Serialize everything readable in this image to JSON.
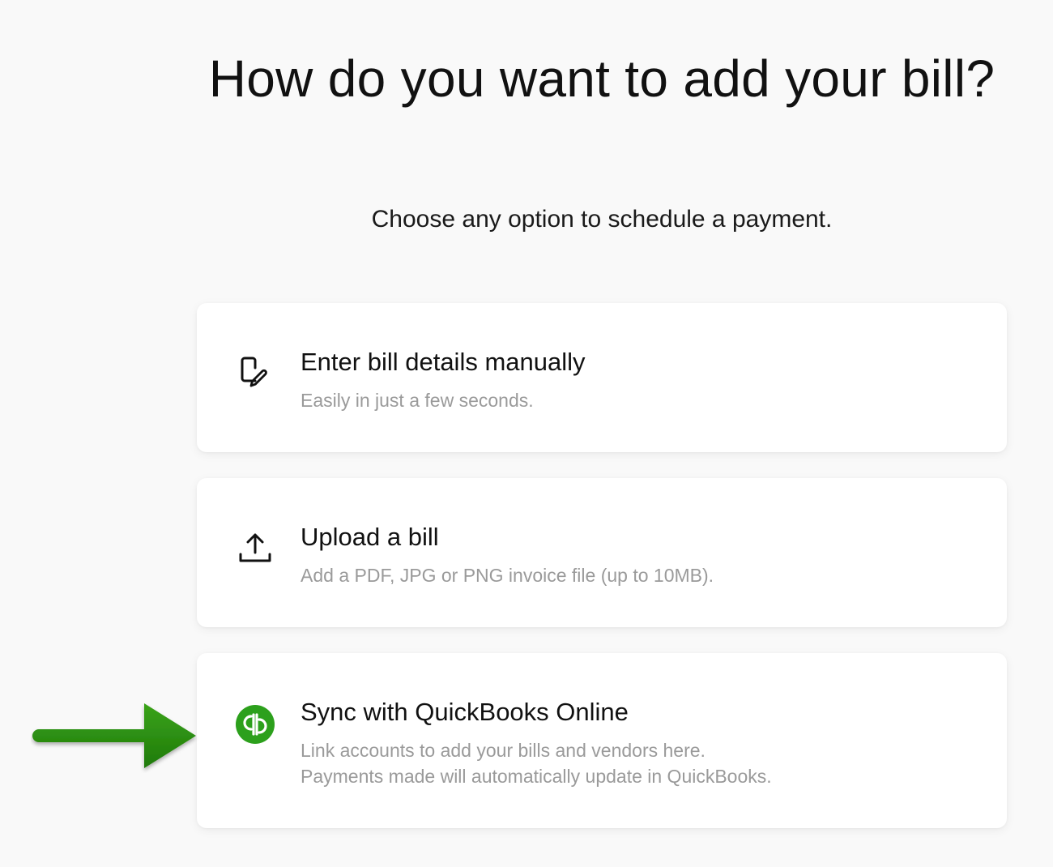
{
  "header": {
    "title": "How do you want to add your bill?",
    "subtitle": "Choose any option to schedule a payment."
  },
  "options": [
    {
      "icon": "document-edit-icon",
      "title": "Enter bill details manually",
      "description_lines": [
        "Easily in just a few seconds."
      ]
    },
    {
      "icon": "upload-icon",
      "title": "Upload a bill",
      "description_lines": [
        "Add a PDF, JPG or PNG invoice file (up to 10MB)."
      ]
    },
    {
      "icon": "quickbooks-logo-icon",
      "title": "Sync with QuickBooks Online",
      "description_lines": [
        "Link accounts to add your bills and vendors here.",
        "Payments made will automatically update in QuickBooks."
      ]
    }
  ],
  "annotation": {
    "icon": "arrow-right-icon",
    "color": "#2a8a10"
  },
  "colors": {
    "background": "#f9f9f9",
    "card": "#ffffff",
    "title": "#111111",
    "description": "#9a9a9a",
    "quickbooks_green": "#2ca01c"
  }
}
